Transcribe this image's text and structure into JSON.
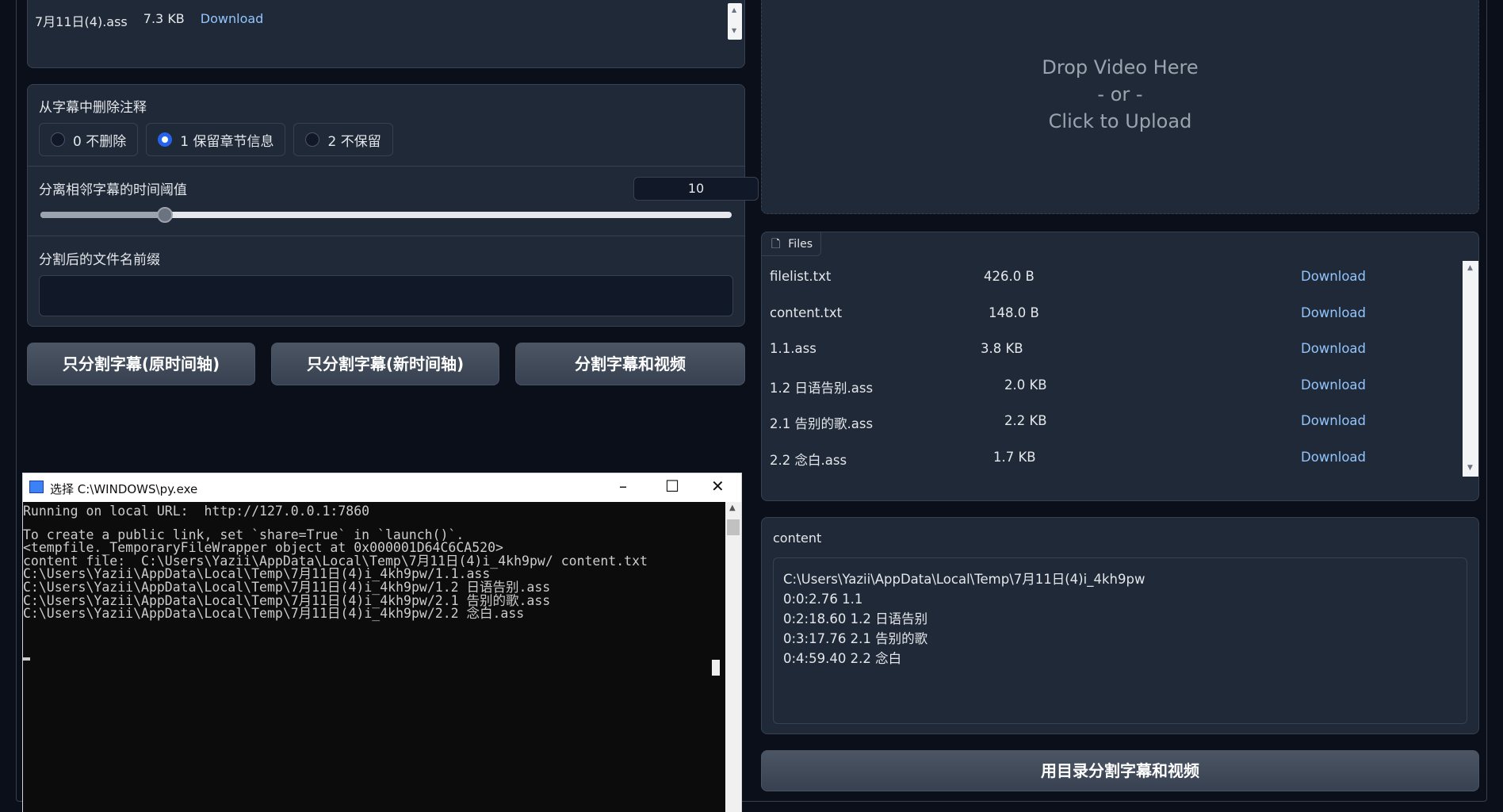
{
  "top_file": {
    "name": "7月11日(4).ass",
    "size": "7.3 KB",
    "download": "Download"
  },
  "options": {
    "remove_notes_label": "从字幕中删除注释",
    "radios": [
      {
        "label": "0 不删除",
        "selected": false
      },
      {
        "label": "1 保留章节信息",
        "selected": true
      },
      {
        "label": "2 不保留",
        "selected": false
      }
    ],
    "threshold_label": "分离相邻字幕的时间阈值",
    "threshold_value": "10",
    "threshold_fraction": 0.18,
    "prefix_label": "分割后的文件名前缀",
    "prefix_value": ""
  },
  "buttons": {
    "split_orig": "只分割字幕(原时间轴)",
    "split_new": "只分割字幕(新时间轴)",
    "split_both": "分割字幕和视频",
    "split_by_dir": "用目录分割字幕和视频"
  },
  "cmd": {
    "title": "选择 C:\\WINDOWS\\py.exe",
    "lines": [
      "Running on local URL:  http://127.0.0.1:7860",
      "",
      "To create a public link, set `share=True` in `launch()`.",
      "<tempfile._TemporaryFileWrapper object at 0x000001D64C6CA520>",
      "content file:  C:\\Users\\Yazii\\AppData\\Local\\Temp\\7月11日(4)i_4kh9pw/ content.txt",
      "C:\\Users\\Yazii\\AppData\\Local\\Temp\\7月11日(4)i_4kh9pw/1.1.ass",
      "C:\\Users\\Yazii\\AppData\\Local\\Temp\\7月11日(4)i_4kh9pw/1.2 日语告别.ass",
      "C:\\Users\\Yazii\\AppData\\Local\\Temp\\7月11日(4)i_4kh9pw/2.1 告别的歌.ass",
      "C:\\Users\\Yazii\\AppData\\Local\\Temp\\7月11日(4)i_4kh9pw/2.2 念白.ass"
    ]
  },
  "drop": {
    "line1": "Drop Video Here",
    "line2": "- or -",
    "line3": "Click to Upload"
  },
  "files": {
    "tab": "Files",
    "rows": [
      {
        "name": "filelist.txt",
        "size": "426.0 B",
        "download": "Download"
      },
      {
        "name": "content.txt",
        "size": "148.0 B",
        "download": "Download"
      },
      {
        "name": "1.1.ass",
        "size": "3.8 KB",
        "download": "Download"
      },
      {
        "name": "1.2 日语告别.ass",
        "size": "2.0 KB",
        "download": "Download"
      },
      {
        "name": "2.1 告别的歌.ass",
        "size": "2.2 KB",
        "download": "Download"
      },
      {
        "name": "2.2 念白.ass",
        "size": "1.7 KB",
        "download": "Download"
      }
    ]
  },
  "content": {
    "label": "content",
    "lines": [
      "C:\\Users\\Yazii\\AppData\\Local\\Temp\\7月11日(4)i_4kh9pw",
      "0:0:2.76   1.1",
      "0:2:18.60 1.2 日语告别",
      "0:3:17.76 2.1 告别的歌",
      "0:4:59.40 2.2 念白"
    ]
  }
}
